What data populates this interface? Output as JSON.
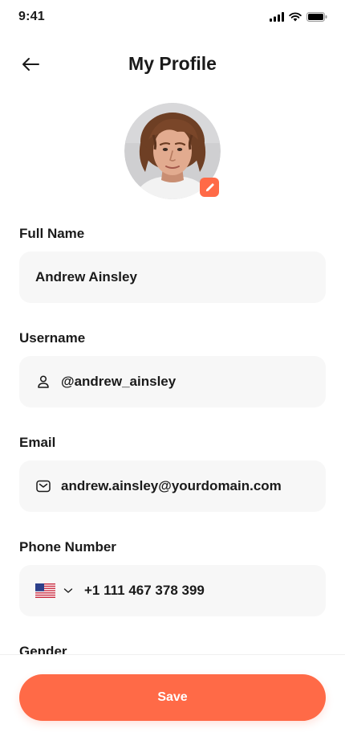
{
  "status_bar": {
    "time": "9:41"
  },
  "header": {
    "title": "My Profile",
    "back_icon": "arrow-left-icon"
  },
  "avatar": {
    "edit_icon": "pencil-icon"
  },
  "fields": {
    "full_name": {
      "label": "Full Name",
      "value": "Andrew Ainsley"
    },
    "username": {
      "label": "Username",
      "value": "@andrew_ainsley",
      "icon": "user-icon"
    },
    "email": {
      "label": "Email",
      "value": "andrew.ainsley@yourdomain.com",
      "icon": "mail-icon"
    },
    "phone": {
      "label": "Phone Number",
      "value": "+1 111 467 378 399",
      "country_icon": "us-flag-icon"
    },
    "gender": {
      "label": "Gender"
    }
  },
  "actions": {
    "save_label": "Save"
  },
  "colors": {
    "accent": "#ff6a47",
    "field_bg": "#f7f7f7",
    "text": "#1a1a1a"
  }
}
